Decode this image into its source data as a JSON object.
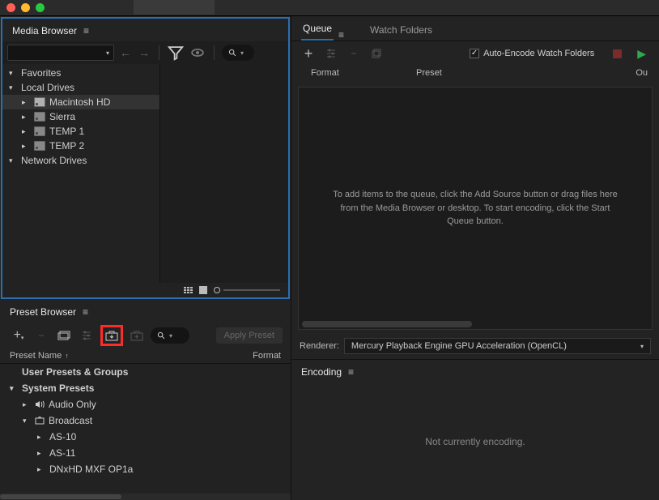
{
  "media_browser": {
    "title": "Media Browser",
    "tree": {
      "favorites": "Favorites",
      "local": "Local Drives",
      "drives": [
        "Macintosh HD",
        "Sierra",
        "TEMP 1",
        "TEMP 2"
      ],
      "network": "Network Drives"
    }
  },
  "preset_browser": {
    "title": "Preset Browser",
    "apply_label": "Apply Preset",
    "col_name": "Preset Name",
    "col_format": "Format",
    "rows": {
      "user": "User Presets & Groups",
      "system": "System Presets",
      "audio": "Audio Only",
      "broadcast": "Broadcast",
      "as10": "AS-10",
      "as11": "AS-11",
      "dnxhd": "DNxHD MXF OP1a"
    }
  },
  "queue": {
    "tab_queue": "Queue",
    "tab_watch": "Watch Folders",
    "auto_encode": "Auto-Encode Watch Folders",
    "col_format": "Format",
    "col_preset": "Preset",
    "col_output": "Ou",
    "drop_hint": "To add items to the queue, click the Add Source button or drag files here from the Media Browser or desktop.  To start encoding, click the Start Queue button."
  },
  "renderer": {
    "label": "Renderer:",
    "value": "Mercury Playback Engine GPU Acceleration (OpenCL)"
  },
  "encoding": {
    "title": "Encoding",
    "status": "Not currently encoding."
  }
}
